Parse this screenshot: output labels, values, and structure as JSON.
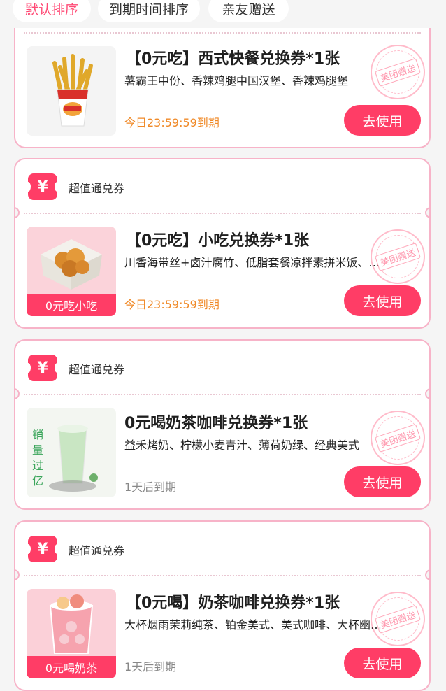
{
  "tabs": [
    {
      "label": "默认排序",
      "active": true
    },
    {
      "label": "到期时间排序",
      "active": false
    },
    {
      "label": "亲友赠送",
      "active": false
    }
  ],
  "coupons": [
    {
      "section_label": "",
      "title": "【0元吃】西式快餐兑换券*1张",
      "desc": "薯霸王中份、香辣鸡腿中国汉堡、香辣鸡腿堡",
      "expire": "今日23:59:59到期",
      "button": "去使用",
      "stamp": "美团赠送",
      "image": "burger-king-fries"
    },
    {
      "section_label": "超值通兑券",
      "title": "【0元吃】小吃兑换券*1张",
      "desc": "川香海带丝+卤汁腐竹、低脂套餐凉拌素拼米饭、素...",
      "expire": "今日23:59:59到期",
      "button": "去使用",
      "stamp": "美团赠送",
      "thumb_tag": "0元吃小吃"
    },
    {
      "section_label": "超值通兑券",
      "title": "0元喝奶茶咖啡兑换券*1张",
      "desc": "益禾烤奶、柠檬小麦青汁、薄荷奶绿、经典美式",
      "expire": "1天后到期",
      "button": "去使用",
      "stamp": "美团赠送",
      "thumb_side_text": "销量过亿"
    },
    {
      "section_label": "超值通兑券",
      "title": "【0元喝】奶茶咖啡兑换券*1张",
      "desc": "大杯烟雨茉莉纯茶、铂金美式、美式咖啡、大杯幽兰...",
      "expire": "1天后到期",
      "button": "去使用",
      "stamp": "美团赠送",
      "thumb_tag": "0元喝奶茶"
    }
  ],
  "colors": {
    "accent": "#ff3d66",
    "expire_today": "#f08a28",
    "expire_later": "#888888",
    "card_border": "#f7b3c8"
  }
}
